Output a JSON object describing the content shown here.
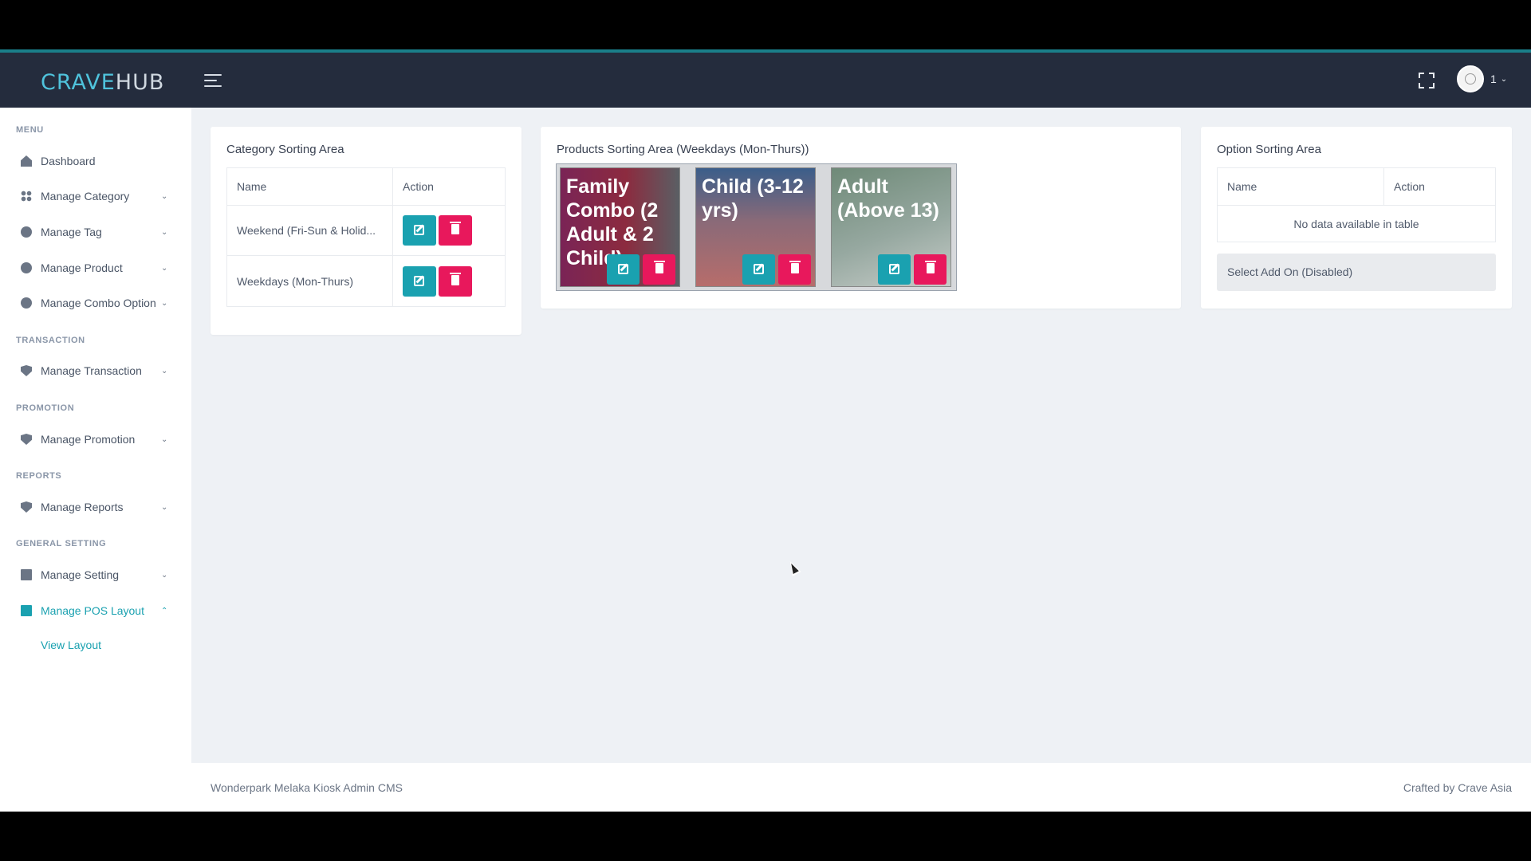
{
  "app": {
    "logo_crave": "CRAVE",
    "logo_hub": "HUB",
    "user_name": "1",
    "user_caret": "⌄"
  },
  "sidebar": {
    "headings": {
      "menu": "MENU",
      "transaction": "TRANSACTION",
      "promotion": "PROMOTION",
      "reports": "REPORTS",
      "general_setting": "GENERAL SETTING"
    },
    "items": [
      {
        "label": "Dashboard",
        "icon": "home-icon"
      },
      {
        "label": "Manage Category",
        "icon": "grid-icon",
        "caret": "⌄"
      },
      {
        "label": "Manage Tag",
        "icon": "circle-icon",
        "caret": "⌄"
      },
      {
        "label": "Manage Product",
        "icon": "circle-icon",
        "caret": "⌄"
      },
      {
        "label": "Manage Combo Option",
        "icon": "circle-icon",
        "caret": "⌄"
      },
      {
        "label": "Manage Transaction",
        "icon": "shield-icon",
        "caret": "⌄"
      },
      {
        "label": "Manage Promotion",
        "icon": "shield-icon",
        "caret": "⌄"
      },
      {
        "label": "Manage Reports",
        "icon": "shield-icon",
        "caret": "⌄"
      },
      {
        "label": "Manage Setting",
        "icon": "building-icon",
        "caret": "⌄"
      },
      {
        "label": "Manage POS Layout",
        "icon": "building-icon",
        "caret": "⌃",
        "active": true
      }
    ],
    "submenu_view_layout": "View Layout",
    "active_color": "#1aa1b0"
  },
  "category_card": {
    "title": "Category Sorting Area",
    "columns": [
      "Name",
      "Action"
    ],
    "rows": [
      {
        "name": "Weekend (Fri-Sun & Holid..."
      },
      {
        "name": "Weekdays (Mon-Thurs)"
      }
    ]
  },
  "products_card": {
    "title": "Products Sorting Area (Weekdays (Mon-Thurs))",
    "tiles": [
      {
        "title": "Family Combo (2 Adult & 2 Child)"
      },
      {
        "title": "Child (3-12 yrs)"
      },
      {
        "title": "Adult (Above 13)"
      }
    ]
  },
  "option_card": {
    "title": "Option Sorting Area",
    "columns": [
      "Name",
      "Action"
    ],
    "empty_text": "No data available in table",
    "select_label": "Select Add On (Disabled)"
  },
  "footer": {
    "left": "Wonderpark Melaka Kiosk Admin CMS",
    "right": "Crafted by Crave Asia"
  },
  "colors": {
    "topbar": "#242c3d",
    "accent": "#1aa1b0",
    "danger": "#e8185c",
    "background": "#eef1f5"
  }
}
